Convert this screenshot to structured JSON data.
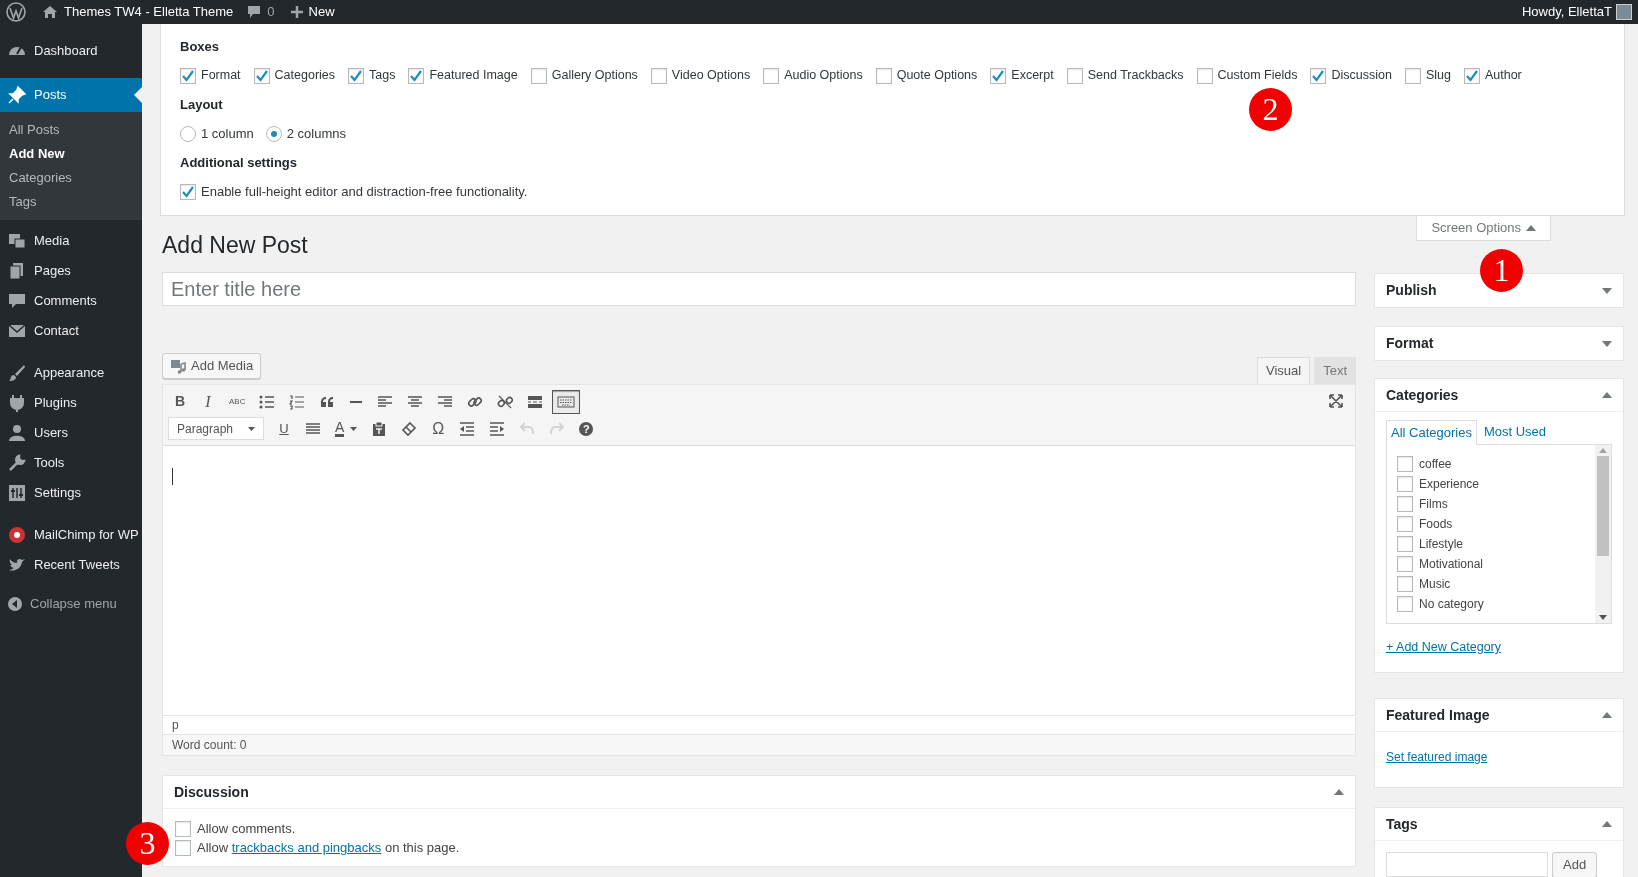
{
  "admin_bar": {
    "site_name": "Themes TW4 - Elletta Theme",
    "comments_count": "0",
    "new_label": "New",
    "greeting": "Howdy, EllettaT"
  },
  "sidebar": {
    "groups": [
      [
        {
          "label": "Dashboard",
          "selected": false
        }
      ],
      [
        {
          "label": "Posts",
          "selected": true,
          "children": [
            {
              "label": "All Posts",
              "selected": false
            },
            {
              "label": "Add New",
              "selected": true
            },
            {
              "label": "Categories",
              "selected": false
            },
            {
              "label": "Tags",
              "selected": false
            }
          ]
        },
        {
          "label": "Media",
          "selected": false
        },
        {
          "label": "Pages",
          "selected": false
        },
        {
          "label": "Comments",
          "selected": false
        },
        {
          "label": "Contact",
          "selected": false
        }
      ],
      [
        {
          "label": "Appearance",
          "selected": false
        },
        {
          "label": "Plugins",
          "selected": false
        },
        {
          "label": "Users",
          "selected": false
        },
        {
          "label": "Tools",
          "selected": false
        },
        {
          "label": "Settings",
          "selected": false
        }
      ],
      [
        {
          "label": "MailChimp for WP",
          "selected": false
        },
        {
          "label": "Recent Tweets",
          "selected": false
        }
      ]
    ],
    "collapse_label": "Collapse menu"
  },
  "screen_options": {
    "expanded": true,
    "toggle_label": "Screen Options",
    "boxes_title": "Boxes",
    "boxes": [
      {
        "label": "Format",
        "checked": true
      },
      {
        "label": "Categories",
        "checked": true
      },
      {
        "label": "Tags",
        "checked": true
      },
      {
        "label": "Featured Image",
        "checked": true
      },
      {
        "label": "Gallery Options",
        "checked": false
      },
      {
        "label": "Video Options",
        "checked": false
      },
      {
        "label": "Audio Options",
        "checked": false
      },
      {
        "label": "Quote Options",
        "checked": false
      },
      {
        "label": "Excerpt",
        "checked": true
      },
      {
        "label": "Send Trackbacks",
        "checked": false
      },
      {
        "label": "Custom Fields",
        "checked": false
      },
      {
        "label": "Discussion",
        "checked": true
      },
      {
        "label": "Slug",
        "checked": false
      },
      {
        "label": "Author",
        "checked": true
      }
    ],
    "layout_title": "Layout",
    "layout_options": [
      {
        "label": "1 column",
        "selected": false
      },
      {
        "label": "2 columns",
        "selected": true
      }
    ],
    "additional_title": "Additional settings",
    "additional": [
      {
        "label": "Enable full-height editor and distraction-free functionality.",
        "checked": true
      }
    ]
  },
  "page_title": "Add New Post",
  "title_field": {
    "placeholder": "Enter title here"
  },
  "editor": {
    "add_media_label": "Add Media",
    "tabs": [
      {
        "label": "Visual",
        "selected": true
      },
      {
        "label": "Text",
        "selected": false
      }
    ],
    "toolbar_rows": [
      [
        {
          "kind": "bold",
          "glyph": "B",
          "pressed": false,
          "disabled": false
        },
        {
          "kind": "italic",
          "glyph": "I",
          "pressed": false,
          "disabled": false
        },
        {
          "kind": "strikethrough",
          "glyph": "ABC",
          "pressed": false,
          "disabled": false
        },
        {
          "kind": "bullet-list",
          "pressed": false,
          "disabled": false
        },
        {
          "kind": "numbered-list",
          "pressed": false,
          "disabled": false
        },
        {
          "kind": "blockquote",
          "pressed": false,
          "disabled": false
        },
        {
          "kind": "horizontal-line",
          "pressed": false,
          "disabled": false
        },
        {
          "kind": "align-left",
          "pressed": false,
          "disabled": false
        },
        {
          "kind": "align-center",
          "pressed": false,
          "disabled": false
        },
        {
          "kind": "align-right",
          "pressed": false,
          "disabled": false
        },
        {
          "kind": "link",
          "pressed": false,
          "disabled": false
        },
        {
          "kind": "unlink",
          "pressed": false,
          "disabled": false
        },
        {
          "kind": "read-more",
          "pressed": false,
          "disabled": false
        },
        {
          "kind": "toolbar-toggle",
          "pressed": true,
          "disabled": false
        }
      ],
      [
        {
          "kind": "format-select",
          "value": "Paragraph"
        },
        {
          "kind": "underline",
          "glyph": "U",
          "pressed": false,
          "disabled": false
        },
        {
          "kind": "justify",
          "pressed": false,
          "disabled": false
        },
        {
          "kind": "text-color",
          "glyph": "A",
          "pressed": false,
          "disabled": false
        },
        {
          "kind": "paste-text",
          "pressed": false,
          "disabled": false
        },
        {
          "kind": "clear-formatting",
          "pressed": false,
          "disabled": false
        },
        {
          "kind": "special-character",
          "glyph": "Ω",
          "pressed": false,
          "disabled": false
        },
        {
          "kind": "outdent",
          "pressed": false,
          "disabled": false
        },
        {
          "kind": "indent",
          "pressed": false,
          "disabled": false
        },
        {
          "kind": "undo",
          "pressed": false,
          "disabled": true
        },
        {
          "kind": "redo",
          "pressed": false,
          "disabled": true
        },
        {
          "kind": "help",
          "glyph": "?",
          "pressed": false,
          "disabled": false
        }
      ]
    ],
    "path": "p",
    "word_count": "Word count: 0"
  },
  "discussion": {
    "title": "Discussion",
    "expanded": true,
    "options": [
      {
        "before": "Allow comments.",
        "checked": false
      },
      {
        "before": "Allow",
        "link": "trackbacks and pingbacks",
        "after": "on this page.",
        "checked": false
      }
    ]
  },
  "side_boxes": [
    {
      "kind": "publish",
      "title": "Publish",
      "expanded": false
    },
    {
      "kind": "format",
      "title": "Format",
      "expanded": false
    },
    {
      "kind": "categories",
      "title": "Categories",
      "expanded": true,
      "tabs": [
        {
          "label": "All Categories",
          "selected": true
        },
        {
          "label": "Most Used",
          "selected": false
        }
      ],
      "items": [
        {
          "label": "coffee",
          "checked": false
        },
        {
          "label": "Experience",
          "checked": false
        },
        {
          "label": "Films",
          "checked": false
        },
        {
          "label": "Foods",
          "checked": false
        },
        {
          "label": "Lifestyle",
          "checked": false
        },
        {
          "label": "Motivational",
          "checked": false
        },
        {
          "label": "Music",
          "checked": false
        },
        {
          "label": "No category",
          "checked": false
        }
      ],
      "add_link": "+ Add New Category"
    },
    {
      "kind": "featured-image",
      "title": "Featured Image",
      "expanded": true,
      "link": "Set featured image"
    },
    {
      "kind": "tags",
      "title": "Tags",
      "expanded": true,
      "button": "Add"
    }
  ],
  "markers": [
    {
      "label": "1"
    },
    {
      "label": "2"
    },
    {
      "label": "3"
    }
  ]
}
